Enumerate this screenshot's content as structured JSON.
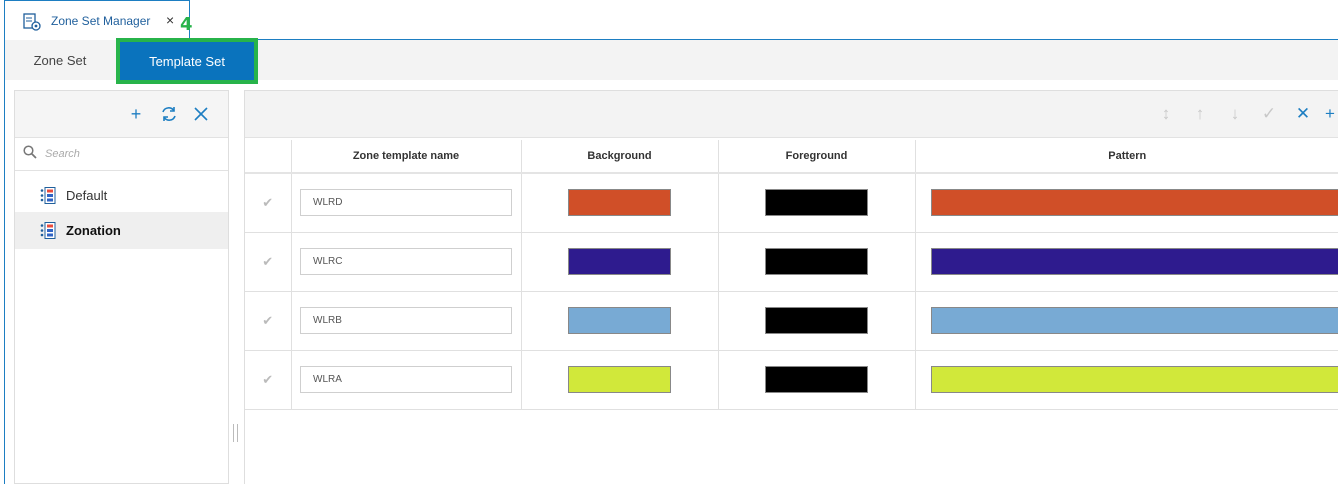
{
  "doc_tab": {
    "title": "Zone Set Manager",
    "close": "×",
    "callout": "4"
  },
  "sub_tabs": [
    {
      "label": "Zone Set",
      "active": false
    },
    {
      "label": "Template Set",
      "active": true
    }
  ],
  "left_panel": {
    "toolbar": {
      "add": "+",
      "refresh": "⟳",
      "delete": "✕"
    },
    "search": {
      "placeholder": "Search",
      "value": ""
    },
    "items": [
      {
        "label": "Default",
        "selected": false
      },
      {
        "label": "Zonation",
        "selected": true
      }
    ]
  },
  "right_panel": {
    "toolbar": {
      "sort": "↕",
      "up": "↑",
      "down": "↓",
      "apply": "✓",
      "delete": "✕",
      "add": "+"
    },
    "columns": [
      "",
      "Zone template name",
      "Background",
      "Foreground",
      "Pattern"
    ],
    "rows": [
      {
        "check": "✔",
        "name": "WLRD",
        "background": "#d04f28",
        "foreground": "#000000",
        "pattern": "#d04f28"
      },
      {
        "check": "✔",
        "name": "WLRC",
        "background": "#2e1b8e",
        "foreground": "#000000",
        "pattern": "#2e1b8e"
      },
      {
        "check": "✔",
        "name": "WLRB",
        "background": "#78aad4",
        "foreground": "#000000",
        "pattern": "#78aad4"
      },
      {
        "check": "✔",
        "name": "WLRA",
        "background": "#d1e83a",
        "foreground": "#000000",
        "pattern": "#d1e83a"
      }
    ]
  },
  "colors": {
    "accent": "#0a73bd",
    "highlight": "#27b34a",
    "tab_text": "#1f5f9c"
  }
}
